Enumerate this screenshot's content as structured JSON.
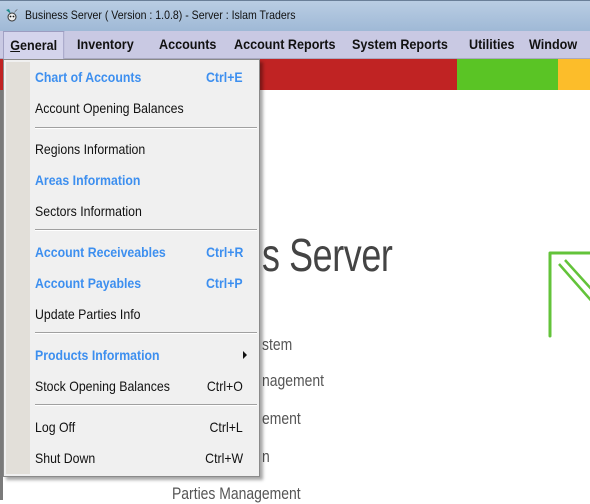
{
  "window": {
    "title": "Business Server  ( Version : 1.0.8)  - Server :  Islam Traders",
    "app_icon": "app-logo-icon"
  },
  "menubar": {
    "items": [
      {
        "label": "General",
        "mnemonic": "G",
        "active": true
      },
      {
        "label": "Inventory"
      },
      {
        "label": "Accounts"
      },
      {
        "label": "Account Reports"
      },
      {
        "label": "System Reports"
      },
      {
        "label": "Utilities"
      },
      {
        "label": "Window"
      }
    ]
  },
  "banner": {
    "colors": [
      "#c02323",
      "#5ac425",
      "#fcbd2a"
    ]
  },
  "content": {
    "title_partial": "s Server",
    "features": [
      "stem",
      "nagement",
      "ement",
      "n",
      "Parties Management"
    ],
    "logo_color": "#63c33a"
  },
  "dropdown": {
    "highlight_color": "#3d8fef",
    "groups": [
      [
        {
          "label": "Chart of Accounts",
          "shortcut": "Ctrl+E",
          "highlighted": true
        },
        {
          "label": "Account Opening Balances",
          "shortcut": ""
        }
      ],
      [
        {
          "label": "Regions Information",
          "shortcut": ""
        },
        {
          "label": "Areas Information",
          "shortcut": "",
          "highlighted": true
        },
        {
          "label": "Sectors Information",
          "shortcut": ""
        }
      ],
      [
        {
          "label": "Account Receiveables",
          "shortcut": "Ctrl+R",
          "highlighted": true
        },
        {
          "label": "Account Payables",
          "shortcut": "Ctrl+P",
          "highlighted": true
        },
        {
          "label": "Update Parties Info",
          "shortcut": ""
        }
      ],
      [
        {
          "label": "Products Information",
          "shortcut": "",
          "highlighted": true,
          "submenu": true
        },
        {
          "label": "Stock Opening Balances",
          "shortcut": "Ctrl+O"
        }
      ],
      [
        {
          "label": "Log Off",
          "shortcut": "Ctrl+L"
        },
        {
          "label": "Shut Down",
          "shortcut": "Ctrl+W"
        }
      ]
    ]
  }
}
